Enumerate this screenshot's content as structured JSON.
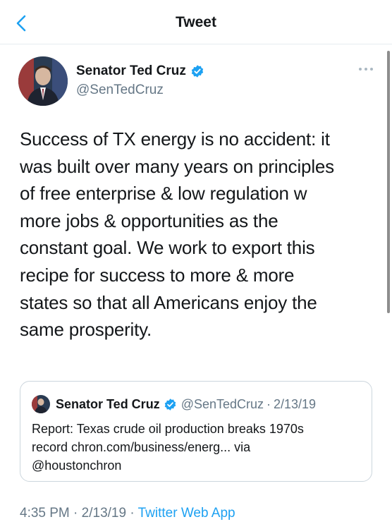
{
  "header": {
    "title": "Tweet",
    "back_icon": "chevron-left-icon",
    "accent": "#1da1f2"
  },
  "tweet": {
    "author_name": "Senator Ted Cruz",
    "author_handle": "@SenTedCruz",
    "verified_color": "#1da1f2",
    "lines": [
      "Success of TX energy is no accident: it",
      "was built over many years on principles",
      "of free enterprise & low regulation w",
      "more jobs & opportunities as the",
      "constant goal. We work to export this",
      "recipe for success to more & more",
      "states so that all Americans enjoy the",
      "same prosperity."
    ],
    "time": "4:35 PM",
    "date": "2/13/19",
    "separator": "·",
    "source": "Twitter Web App"
  },
  "quoted": {
    "author_name": "Senator Ted Cruz",
    "author_handle": "@SenTedCruz",
    "separator": "·",
    "date": "2/13/19",
    "lines": [
      "Report: Texas crude oil production breaks 1970s",
      "record chron.com/business/energ... via",
      "@houstonchron"
    ]
  }
}
